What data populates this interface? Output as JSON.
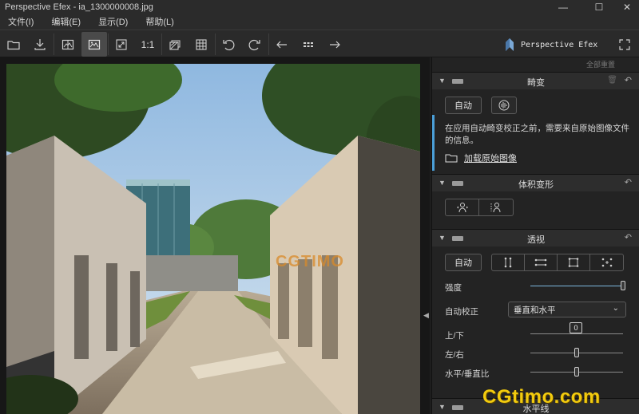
{
  "window": {
    "title": "Perspective Efex - ia_1300000008.jpg"
  },
  "menu": [
    "文件(I)",
    "编辑(E)",
    "显示(D)",
    "帮助(L)"
  ],
  "toolbar": {
    "one_to_one": "1:1",
    "brand": "Perspective Efex",
    "icons": [
      "folder-open-icon",
      "download-icon",
      "image-compare-icon",
      "image-single-icon",
      "fit-icon",
      "one-to-one",
      "overlay-icon",
      "grid-icon",
      "rotate-left-icon",
      "rotate-right-icon",
      "arrow-left-icon",
      "thumbnail-grid-icon",
      "arrow-right-icon",
      "fullscreen-icon"
    ]
  },
  "panel": {
    "reset_all": "全部重置",
    "distortion": {
      "title": "畸变",
      "auto_label": "自动",
      "info_text": "在应用自动畸变校正之前，需要来自原始图像文件的信息。",
      "load_original": "加载原始图像"
    },
    "volume": {
      "title": "体积变形"
    },
    "perspective": {
      "title": "透视",
      "auto_label": "自动",
      "strength_label": "强度",
      "strength": 1.0,
      "auto_correct_label": "自动校正",
      "auto_correct_value": "垂直和水平",
      "updown_label": "上/下",
      "updown_value": "0",
      "leftright_label": "左/右",
      "leftright": 0.5,
      "hv_ratio_label": "水平/垂直比",
      "hv_ratio": 0.5
    },
    "next_section": {
      "title": "水平线"
    }
  },
  "watermarks": {
    "image_mark": "CGTIMO",
    "corner_mark": "CGtimo.com"
  },
  "colors": {
    "accent_blue": "#4b9fd8",
    "watermark_yellow": "#f2cb0e"
  }
}
